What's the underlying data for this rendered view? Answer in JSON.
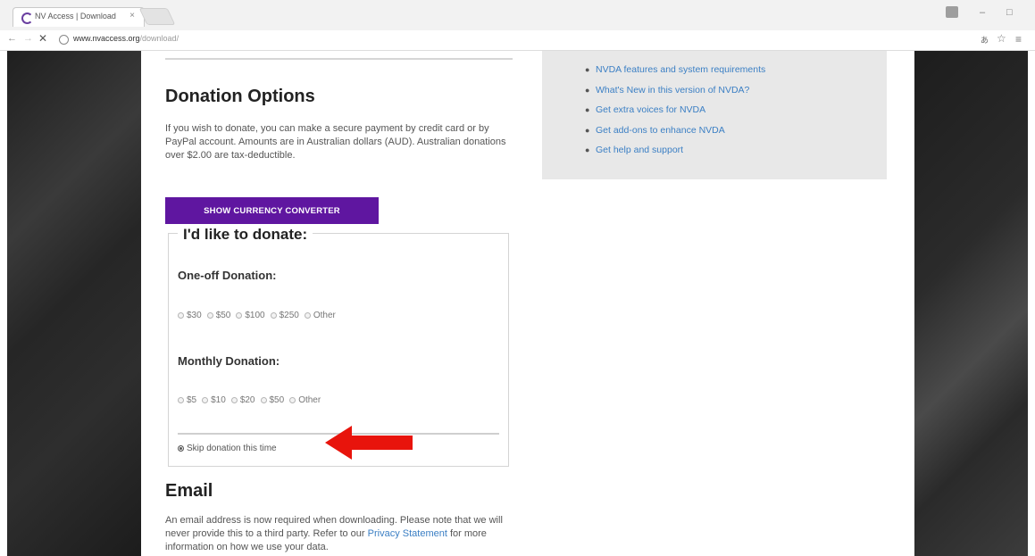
{
  "browser": {
    "tab_title": "NV Access | Download",
    "tab_close": "×",
    "url_host": "www.nvaccess.org",
    "url_path": "/download/",
    "back": "←",
    "forward": "→",
    "stop": "✕",
    "star": "☆",
    "menu": "≡",
    "translate": "あ",
    "minimize": "–",
    "maximize": "□"
  },
  "sidebar": {
    "links": [
      "NVDA features and system requirements",
      "What's New in this version of NVDA?",
      "Get extra voices for NVDA",
      "Get add-ons to enhance NVDA",
      "Get help and support"
    ]
  },
  "donation": {
    "heading": "Donation Options",
    "intro": "If you wish to donate, you can make a secure payment by credit card or by PayPal account. Amounts are in Australian dollars (AUD). Australian donations over $2.00 are tax-deductible.",
    "currency_button": "SHOW CURRENCY CONVERTER",
    "form_heading": "I'd like to donate:",
    "one_off_heading": "One-off Donation:",
    "one_off_options": [
      "$30",
      "$50",
      "$100",
      "$250",
      "Other"
    ],
    "monthly_heading": "Monthly Donation:",
    "monthly_options": [
      "$5",
      "$10",
      "$20",
      "$50",
      "Other"
    ],
    "skip_label": "Skip donation this time",
    "skip_selected": true
  },
  "email": {
    "heading": "Email",
    "text_before": "An email address is now required when downloading. Please note that we will never provide this to a third party. Refer to our ",
    "link": "Privacy Statement",
    "text_after": " for more information on how we use your data."
  },
  "colors": {
    "accent_purple": "#5f16a0",
    "link_blue": "#3b7fc4",
    "annotation_red": "#e8140c"
  }
}
